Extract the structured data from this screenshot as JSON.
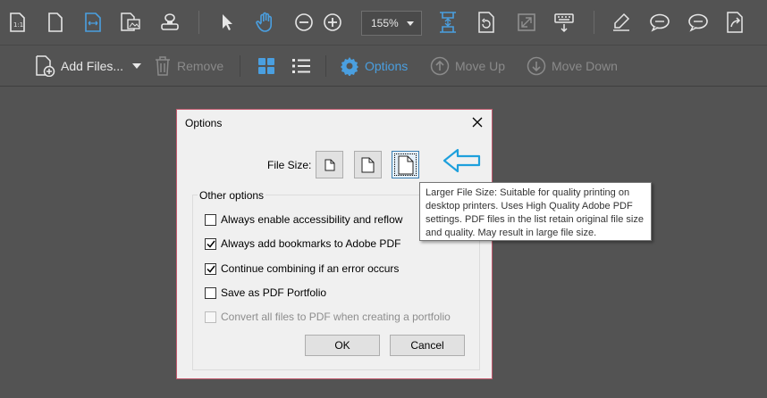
{
  "toolbar": {
    "zoom_value": "155%"
  },
  "combine_toolbar": {
    "add_files": "Add Files...",
    "remove": "Remove",
    "options": "Options",
    "move_up": "Move Up",
    "move_down": "Move Down"
  },
  "dialog": {
    "title": "Options",
    "file_size_label": "File Size:",
    "other_options_label": "Other options",
    "checkboxes": [
      {
        "label": "Always enable accessibility and reflow",
        "checked": false,
        "enabled": true
      },
      {
        "label": "Always add bookmarks to Adobe PDF",
        "checked": true,
        "enabled": true
      },
      {
        "label": "Continue combining if an error occurs",
        "checked": true,
        "enabled": true
      },
      {
        "label": "Save as PDF Portfolio",
        "checked": false,
        "enabled": true
      },
      {
        "label": "Convert all files to PDF when creating a portfolio",
        "checked": false,
        "enabled": false
      }
    ],
    "ok_label": "OK",
    "cancel_label": "Cancel"
  },
  "tooltip": {
    "text": "Larger File Size: Suitable for quality printing on desktop printers. Uses High Quality Adobe PDF settings. PDF files in the list retain original file size and quality. May result in large file size."
  },
  "colors": {
    "background": "#535353",
    "accent": "#4a9fe0",
    "arrow": "#1ea0dc",
    "dialog_border": "#c25a6e"
  }
}
